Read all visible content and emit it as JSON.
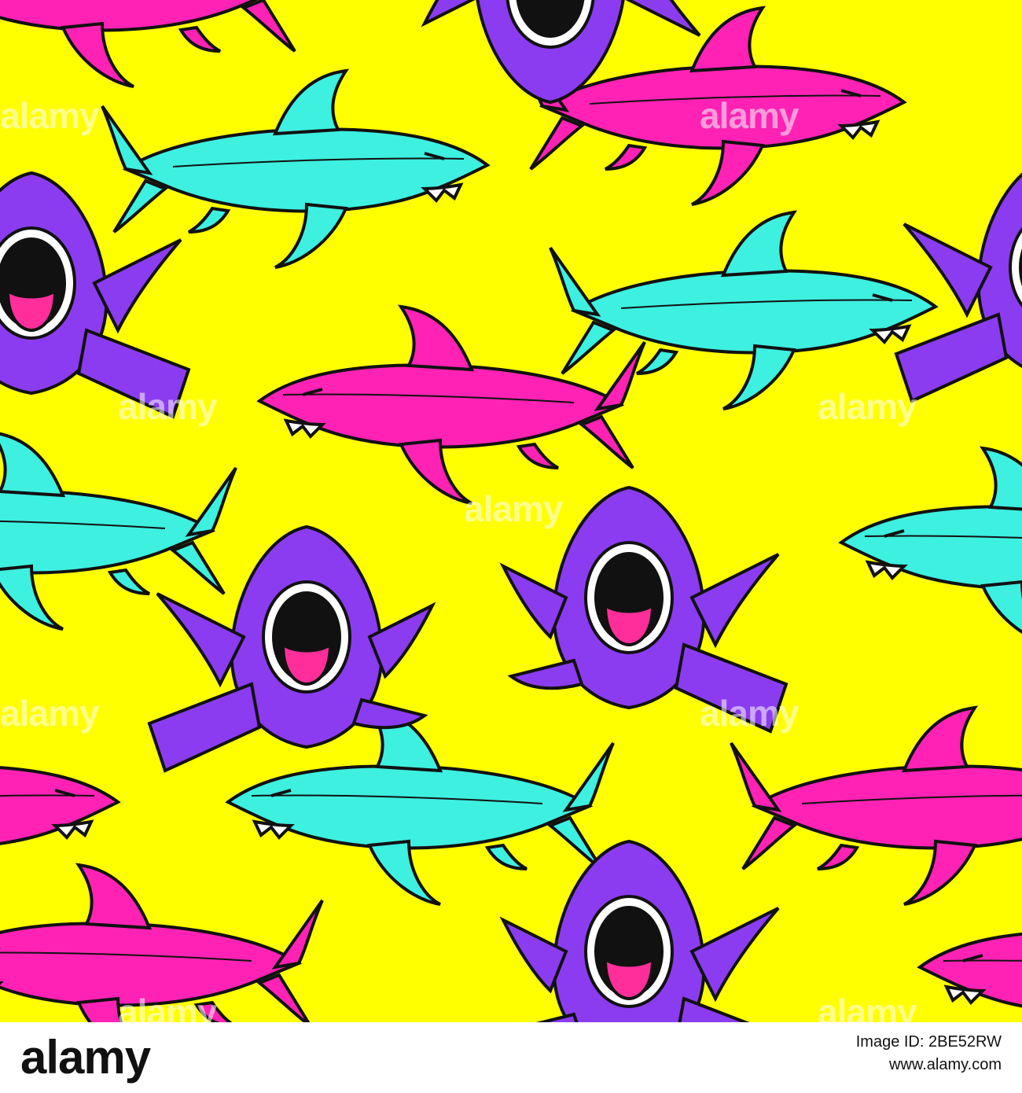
{
  "image": {
    "background_color": "#ffff00",
    "shark_colors": {
      "pink": "#ff22b4",
      "teal": "#3df0e0",
      "purple": "#8b3cf0",
      "tongue": "#ff2e9a",
      "outline": "#111111"
    },
    "watermark_text": "alamy"
  },
  "footer": {
    "logo": "alamy",
    "image_id_label": "Image ID: 2BE52RW",
    "url": "www.alamy.com"
  }
}
